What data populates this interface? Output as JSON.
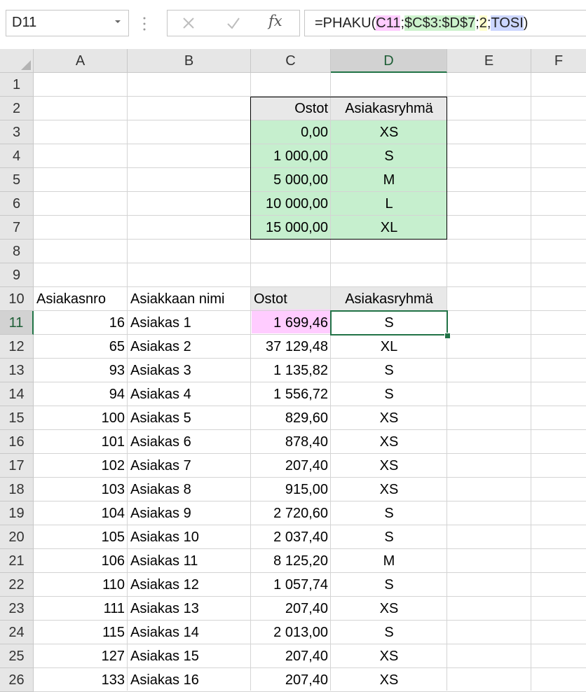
{
  "name_box": {
    "value": "D11"
  },
  "formula_bar": {
    "fx_label": "fx",
    "parts": [
      "=PHAKU(",
      "C11",
      ";",
      "$C$3:$D$7",
      ";",
      "2",
      ";",
      "TOSI",
      ")"
    ]
  },
  "columns": [
    "A",
    "B",
    "C",
    "D",
    "E",
    "F"
  ],
  "rows": [
    "1",
    "2",
    "3",
    "4",
    "5",
    "6",
    "7",
    "8",
    "9",
    "10",
    "11",
    "12",
    "13",
    "14",
    "15",
    "16",
    "17",
    "18",
    "19",
    "20",
    "21",
    "22",
    "23",
    "24",
    "25",
    "26"
  ],
  "lookup_table": {
    "headers": [
      "Ostot",
      "Asiakasryhmä"
    ],
    "rows": [
      [
        "0,00",
        "XS"
      ],
      [
        "1 000,00",
        "S"
      ],
      [
        "5 000,00",
        "M"
      ],
      [
        "10 000,00",
        "L"
      ],
      [
        "15 000,00",
        "XL"
      ]
    ]
  },
  "customer_table": {
    "headers": [
      "Asiakasnro",
      "Asiakkaan nimi",
      "Ostot",
      "Asiakasryhmä"
    ],
    "rows": [
      [
        "16",
        "Asiakas 1",
        "1 699,46",
        "S"
      ],
      [
        "65",
        "Asiakas 2",
        "37 129,48",
        "XL"
      ],
      [
        "93",
        "Asiakas 3",
        "1 135,82",
        "S"
      ],
      [
        "94",
        "Asiakas 4",
        "1 556,72",
        "S"
      ],
      [
        "100",
        "Asiakas 5",
        "829,60",
        "XS"
      ],
      [
        "101",
        "Asiakas 6",
        "878,40",
        "XS"
      ],
      [
        "102",
        "Asiakas 7",
        "207,40",
        "XS"
      ],
      [
        "103",
        "Asiakas 8",
        "915,00",
        "XS"
      ],
      [
        "104",
        "Asiakas 9",
        "2 720,60",
        "S"
      ],
      [
        "105",
        "Asiakas 10",
        "2 037,40",
        "S"
      ],
      [
        "106",
        "Asiakas 11",
        "8 125,20",
        "M"
      ],
      [
        "110",
        "Asiakas 12",
        "1 057,74",
        "S"
      ],
      [
        "111",
        "Asiakas 13",
        "207,40",
        "XS"
      ],
      [
        "115",
        "Asiakas 14",
        "2 013,00",
        "S"
      ],
      [
        "127",
        "Asiakas 15",
        "207,40",
        "XS"
      ],
      [
        "133",
        "Asiakas 16",
        "207,40",
        "XS"
      ]
    ]
  },
  "colors": {
    "lookup_fill": "#c6efce",
    "header_fill": "#e8e8e8",
    "selection_green": "#217346",
    "ref_pink": "#ffccff"
  }
}
